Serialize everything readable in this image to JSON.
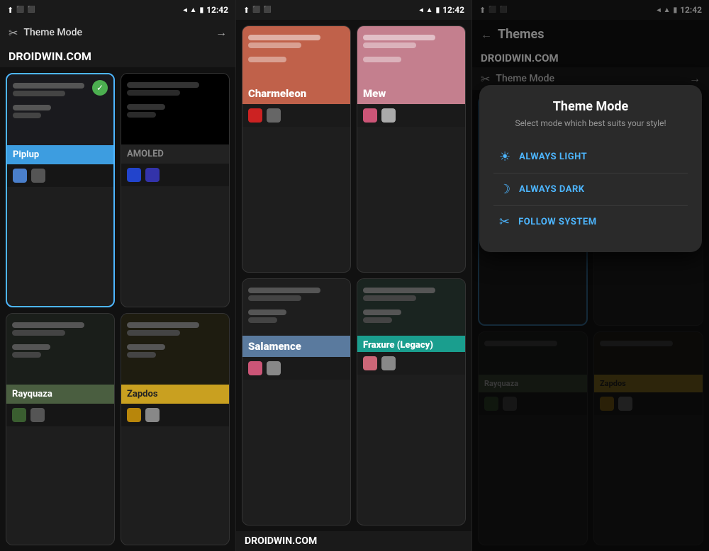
{
  "panel1": {
    "status": {
      "time": "12:42"
    },
    "header": {
      "icon": "✂",
      "title": "Theme Mode",
      "arrow": "→"
    },
    "brand": "DROIDWIN.COM",
    "themes": [
      {
        "id": "piplup",
        "name": "Piplup",
        "selected": true,
        "labelBg": "#3d9de0",
        "previewBg": "#1a1a1e",
        "swatches": [
          "#4a7fcb",
          "#555"
        ]
      },
      {
        "id": "amoled",
        "name": "AMOLED",
        "selected": false,
        "labelBg": "#222",
        "previewBg": "#000",
        "swatches": [
          "#2244cc",
          "#3333aa"
        ]
      },
      {
        "id": "rayquaza",
        "name": "Rayquaza",
        "selected": false,
        "labelBg": "#4a5e40",
        "previewBg": "#1a1e1a",
        "swatches": [
          "#3a5e30",
          "#555"
        ]
      },
      {
        "id": "zapdos",
        "name": "Zapdos",
        "selected": false,
        "labelBg": "#c9a020",
        "previewBg": "#1e1c10",
        "swatches": [
          "#b8860b",
          "#888"
        ]
      }
    ]
  },
  "panel2": {
    "status": {
      "time": "12:42"
    },
    "brand": "DROIDWIN.COM",
    "themes": [
      {
        "id": "charmeleon",
        "name": "Charmeleon",
        "labelBg": "#c0614a",
        "previewBg": "#c0614a",
        "swatches": [
          "#cc2222",
          "#666"
        ]
      },
      {
        "id": "mew",
        "name": "Mew",
        "labelBg": "#c47f8e",
        "previewBg": "#c47f8e",
        "swatches": [
          "#cc5577",
          "#aaa"
        ]
      },
      {
        "id": "salamence",
        "name": "Salamence",
        "labelBg": "#5a7a9e",
        "previewBg": "#1e1e1e",
        "swatches": [
          "#cc5577",
          "#888"
        ]
      },
      {
        "id": "fraxure",
        "name": "Fraxure (Legacy)",
        "labelBg": "#1a9e8e",
        "previewBg": "#1a1e1e",
        "swatches": [
          "#cc6677",
          "#888"
        ]
      }
    ]
  },
  "panel3": {
    "status": {
      "time": "12:42"
    },
    "header": {
      "back": "←",
      "title": "Themes"
    },
    "brand": "DROIDWIN.COM",
    "subheader": {
      "icon": "✂",
      "title": "Theme Mode",
      "arrow": "→"
    },
    "modal": {
      "title": "Theme Mode",
      "subtitle": "Select mode which best suits your style!",
      "options": [
        {
          "id": "always-light",
          "icon": "☀",
          "label": "ALWAYS LIGHT"
        },
        {
          "id": "always-dark",
          "icon": "☽",
          "label": "ALWAYS DARK"
        },
        {
          "id": "follow-system",
          "icon": "✂",
          "label": "FOLLOW SYSTEM"
        }
      ]
    }
  }
}
